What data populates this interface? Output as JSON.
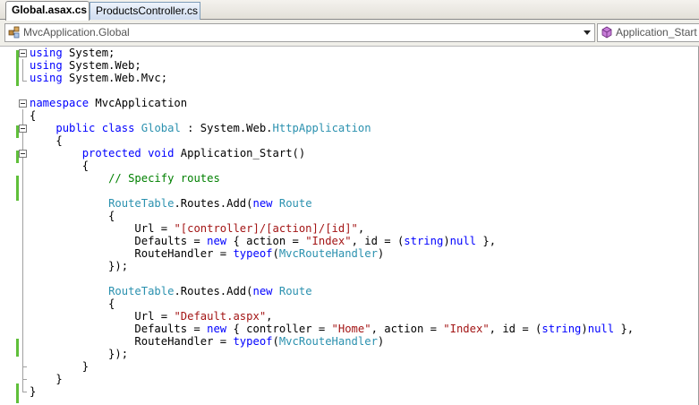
{
  "tabs": [
    {
      "label": "Global.asax.cs",
      "active": true
    },
    {
      "label": "ProductsController.cs",
      "active": false
    }
  ],
  "navbar": {
    "type_combo": "MvcApplication.Global",
    "member_combo": "Application_Start"
  },
  "colors": {
    "keyword": "#0000ff",
    "type": "#2b91af",
    "string": "#a31515",
    "comment": "#008000",
    "change_bar": "#5fbf3a"
  },
  "code_lines": [
    [
      [
        "kw",
        "using"
      ],
      [
        "t",
        " System;"
      ]
    ],
    [
      [
        "kw",
        "using"
      ],
      [
        "t",
        " System.Web;"
      ]
    ],
    [
      [
        "kw",
        "using"
      ],
      [
        "t",
        " System.Web.Mvc;"
      ]
    ],
    [],
    [
      [
        "kw",
        "namespace"
      ],
      [
        "t",
        " MvcApplication"
      ]
    ],
    [
      [
        "t",
        "{"
      ]
    ],
    [
      [
        "t",
        "    "
      ],
      [
        "kw",
        "public"
      ],
      [
        "t",
        " "
      ],
      [
        "kw",
        "class"
      ],
      [
        "t",
        " "
      ],
      [
        "ty",
        "Global"
      ],
      [
        "t",
        " : System.Web."
      ],
      [
        "ty",
        "HttpApplication"
      ]
    ],
    [
      [
        "t",
        "    {"
      ]
    ],
    [
      [
        "t",
        "        "
      ],
      [
        "kw",
        "protected"
      ],
      [
        "t",
        " "
      ],
      [
        "kw",
        "void"
      ],
      [
        "t",
        " Application_Start()"
      ]
    ],
    [
      [
        "t",
        "        {"
      ]
    ],
    [
      [
        "t",
        "            "
      ],
      [
        "cm",
        "// Specify routes"
      ]
    ],
    [],
    [
      [
        "t",
        "            "
      ],
      [
        "ty",
        "RouteTable"
      ],
      [
        "t",
        ".Routes.Add("
      ],
      [
        "kw",
        "new"
      ],
      [
        "t",
        " "
      ],
      [
        "ty",
        "Route"
      ]
    ],
    [
      [
        "t",
        "            {"
      ]
    ],
    [
      [
        "t",
        "                Url = "
      ],
      [
        "st",
        "\"[controller]/[action]/[id]\""
      ],
      [
        "t",
        ","
      ]
    ],
    [
      [
        "t",
        "                Defaults = "
      ],
      [
        "kw",
        "new"
      ],
      [
        "t",
        " { action = "
      ],
      [
        "st",
        "\"Index\""
      ],
      [
        "t",
        ", id = ("
      ],
      [
        "kw",
        "string"
      ],
      [
        "t",
        ")"
      ],
      [
        "kw",
        "null"
      ],
      [
        "t",
        " },"
      ]
    ],
    [
      [
        "t",
        "                RouteHandler = "
      ],
      [
        "kw",
        "typeof"
      ],
      [
        "t",
        "("
      ],
      [
        "ty",
        "MvcRouteHandler"
      ],
      [
        "t",
        ")"
      ]
    ],
    [
      [
        "t",
        "            });"
      ]
    ],
    [],
    [
      [
        "t",
        "            "
      ],
      [
        "ty",
        "RouteTable"
      ],
      [
        "t",
        ".Routes.Add("
      ],
      [
        "kw",
        "new"
      ],
      [
        "t",
        " "
      ],
      [
        "ty",
        "Route"
      ]
    ],
    [
      [
        "t",
        "            {"
      ]
    ],
    [
      [
        "t",
        "                Url = "
      ],
      [
        "st",
        "\"Default.aspx\""
      ],
      [
        "t",
        ","
      ]
    ],
    [
      [
        "t",
        "                Defaults = "
      ],
      [
        "kw",
        "new"
      ],
      [
        "t",
        " { controller = "
      ],
      [
        "st",
        "\"Home\""
      ],
      [
        "t",
        ", action = "
      ],
      [
        "st",
        "\"Index\""
      ],
      [
        "t",
        ", id = ("
      ],
      [
        "kw",
        "string"
      ],
      [
        "t",
        ")"
      ],
      [
        "kw",
        "null"
      ],
      [
        "t",
        " },"
      ]
    ],
    [
      [
        "t",
        "                RouteHandler = "
      ],
      [
        "kw",
        "typeof"
      ],
      [
        "t",
        "("
      ],
      [
        "ty",
        "MvcRouteHandler"
      ],
      [
        "t",
        ")"
      ]
    ],
    [
      [
        "t",
        "            });"
      ]
    ],
    [
      [
        "t",
        "        }"
      ]
    ],
    [
      [
        "t",
        "    }"
      ]
    ],
    [
      [
        "t",
        "}"
      ]
    ]
  ]
}
